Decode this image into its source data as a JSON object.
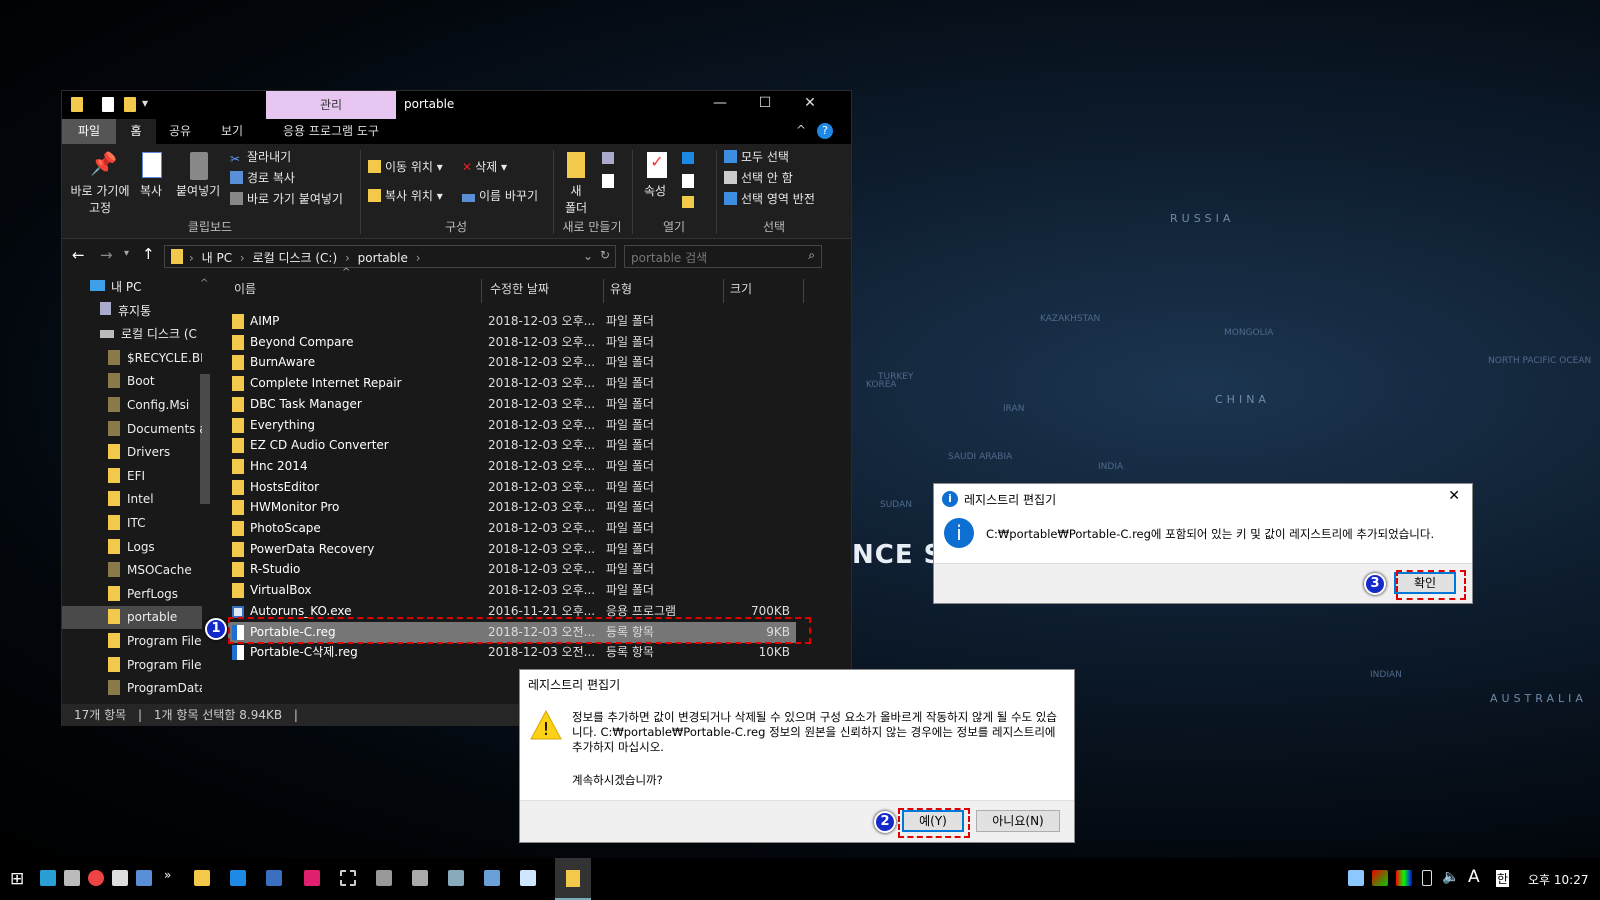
{
  "background": {
    "labels": [
      "RUSSIA",
      "KAZAKHSTAN",
      "MONGOLIA",
      "CHINA",
      "INDIA",
      "IRAN",
      "SAUDI ARABIA",
      "SUDAN",
      "TURKEY",
      "NORTH PACIFIC OCEAN",
      "AUSTRALIA",
      "INDIAN",
      "KOREA",
      "NCE SER"
    ]
  },
  "explorer": {
    "title": "portable",
    "context_tab": "관리",
    "context_tab_sub": "응용 프로그램 도구",
    "window_controls": {
      "minimize": "—",
      "maximize": "☐",
      "close": "✕"
    },
    "tabs": [
      "파일",
      "홈",
      "공유",
      "보기"
    ],
    "ribbon": {
      "clipboard": {
        "pin": "바로 가기에",
        "pin2": "고정",
        "copy": "복사",
        "paste": "붙여넣기",
        "cut": "잘라내기",
        "copy_path": "경로 복사",
        "paste_shortcut": "바로 가기 붙여넣기",
        "group": "클립보드"
      },
      "organize": {
        "move_to": "이동 위치",
        "copy_to": "복사 위치",
        "delete": "삭제",
        "rename": "이름 바꾸기",
        "group": "구성"
      },
      "new": {
        "new_folder": "새",
        "new_folder2": "폴더",
        "group": "새로 만들기"
      },
      "open": {
        "properties": "속성",
        "group": "열기"
      },
      "select": {
        "select_all": "모두 선택",
        "select_none": "선택 안 함",
        "invert": "선택 영역 반전",
        "group": "선택"
      }
    },
    "address": {
      "crumbs": [
        "내 PC",
        "로컬 디스크 (C:)",
        "portable"
      ],
      "search_placeholder": "portable 검색"
    },
    "nav": [
      {
        "label": "내 PC",
        "kind": "pc"
      },
      {
        "label": "휴지통",
        "kind": "bin"
      },
      {
        "label": "로컬 디스크 (C",
        "kind": "drive"
      },
      {
        "label": "$RECYCLE.BI",
        "kind": "hidden"
      },
      {
        "label": "Boot",
        "kind": "hidden"
      },
      {
        "label": "Config.Msi",
        "kind": "hidden"
      },
      {
        "label": "Documents a",
        "kind": "hidden"
      },
      {
        "label": "Drivers",
        "kind": "folder"
      },
      {
        "label": "EFI",
        "kind": "folder"
      },
      {
        "label": "Intel",
        "kind": "folder"
      },
      {
        "label": "ITC",
        "kind": "folder"
      },
      {
        "label": "Logs",
        "kind": "folder"
      },
      {
        "label": "MSOCache",
        "kind": "hidden"
      },
      {
        "label": "PerfLogs",
        "kind": "folder"
      },
      {
        "label": "portable",
        "kind": "folder",
        "selected": true
      },
      {
        "label": "Program File",
        "kind": "folder"
      },
      {
        "label": "Program File",
        "kind": "folder"
      },
      {
        "label": "ProgramData",
        "kind": "hidden"
      }
    ],
    "columns": [
      "이름",
      "수정한 날짜",
      "유형",
      "크기"
    ],
    "files": [
      {
        "name": "AIMP",
        "date": "2018-12-03 오후...",
        "type": "파일 폴더",
        "size": "",
        "icon": "folder"
      },
      {
        "name": "Beyond Compare",
        "date": "2018-12-03 오후...",
        "type": "파일 폴더",
        "size": "",
        "icon": "folder"
      },
      {
        "name": "BurnAware",
        "date": "2018-12-03 오후...",
        "type": "파일 폴더",
        "size": "",
        "icon": "folder"
      },
      {
        "name": "Complete Internet Repair",
        "date": "2018-12-03 오후...",
        "type": "파일 폴더",
        "size": "",
        "icon": "folder"
      },
      {
        "name": "DBC Task Manager",
        "date": "2018-12-03 오후...",
        "type": "파일 폴더",
        "size": "",
        "icon": "folder"
      },
      {
        "name": "Everything",
        "date": "2018-12-03 오후...",
        "type": "파일 폴더",
        "size": "",
        "icon": "folder"
      },
      {
        "name": "EZ CD Audio Converter",
        "date": "2018-12-03 오후...",
        "type": "파일 폴더",
        "size": "",
        "icon": "folder"
      },
      {
        "name": "Hnc 2014",
        "date": "2018-12-03 오후...",
        "type": "파일 폴더",
        "size": "",
        "icon": "folder"
      },
      {
        "name": "HostsEditor",
        "date": "2018-12-03 오후...",
        "type": "파일 폴더",
        "size": "",
        "icon": "folder"
      },
      {
        "name": "HWMonitor Pro",
        "date": "2018-12-03 오후...",
        "type": "파일 폴더",
        "size": "",
        "icon": "folder"
      },
      {
        "name": "PhotoScape",
        "date": "2018-12-03 오후...",
        "type": "파일 폴더",
        "size": "",
        "icon": "folder"
      },
      {
        "name": "PowerData Recovery",
        "date": "2018-12-03 오후...",
        "type": "파일 폴더",
        "size": "",
        "icon": "folder"
      },
      {
        "name": "R-Studio",
        "date": "2018-12-03 오후...",
        "type": "파일 폴더",
        "size": "",
        "icon": "folder"
      },
      {
        "name": "VirtualBox",
        "date": "2018-12-03 오후...",
        "type": "파일 폴더",
        "size": "",
        "icon": "folder"
      },
      {
        "name": "Autoruns_KO.exe",
        "date": "2016-11-21 오후...",
        "type": "응용 프로그램",
        "size": "700KB",
        "icon": "exe"
      },
      {
        "name": "Portable-C.reg",
        "date": "2018-12-03 오전...",
        "type": "등록 항목",
        "size": "9KB",
        "icon": "reg",
        "selected": true
      },
      {
        "name": "Portable-C삭제.reg",
        "date": "2018-12-03 오전...",
        "type": "등록 항목",
        "size": "10KB",
        "icon": "reg"
      }
    ],
    "status": {
      "count": "17개 항목",
      "selected": "1개 항목 선택함 8.94KB"
    }
  },
  "dialog_warning": {
    "title": "레지스트리 편집기",
    "message": "정보를 추가하면 값이 변경되거나 삭제될 수 있으며 구성 요소가 올바르게 작동하지 않게 될 수도 있습니다. C:₩portable₩Portable-C.reg 정보의 원본을 신뢰하지 않는 경우에는 정보를 레지스트리에 추가하지 마십시오.",
    "question": "계속하시겠습니까?",
    "yes": "예(Y)",
    "no": "아니요(N)"
  },
  "dialog_info": {
    "title": "레지스트리 편집기",
    "message": "C:₩portable₩Portable-C.reg에 포함되어 있는 키 및 값이 레지스트리에 추가되었습니다.",
    "ok": "확인",
    "close": "✕"
  },
  "annotations": [
    "1",
    "2",
    "3"
  ],
  "annotation_color": "#e00000",
  "taskbar": {
    "ime_lang": "A",
    "ime_mode": "한",
    "clock": "오후 10:27"
  }
}
